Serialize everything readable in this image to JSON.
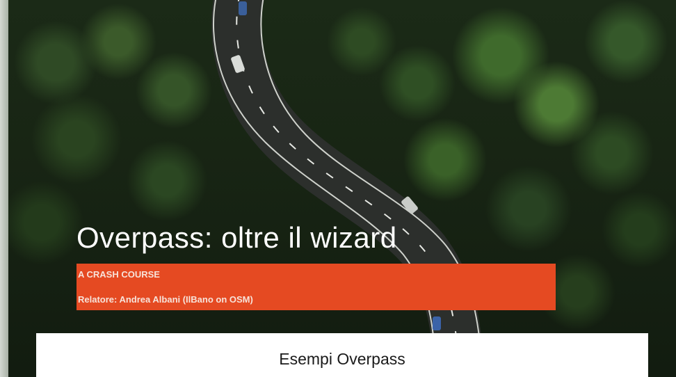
{
  "slide": {
    "title": "Overpass: oltre il wizard",
    "subtitle": "A CRASH COURSE",
    "speaker": "Relatore: Andrea Albani (IlBano on OSM)",
    "caption": "Esempi Overpass"
  },
  "colors": {
    "banner": "#e54a22",
    "caption_background": "#ffffff",
    "title_text": "#ffffff"
  }
}
